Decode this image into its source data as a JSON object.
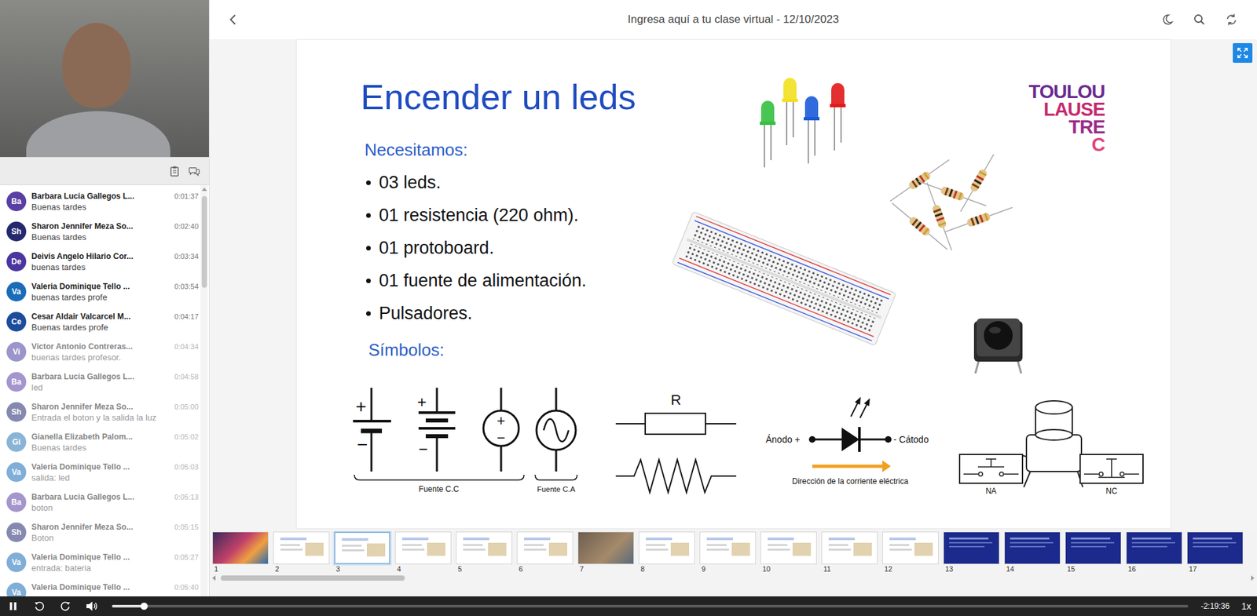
{
  "window": {
    "title": "Ingresa aquí a tu clase virtual - 12/10/2023"
  },
  "chat": {
    "messages": [
      {
        "initials": "Ba",
        "name": "Barbara Lucia Gallegos L...",
        "time": "0:01:37",
        "text": "Buenas tardes",
        "color": "#5a3fa3",
        "faded": false
      },
      {
        "initials": "Sh",
        "name": "Sharon Jennifer Meza So...",
        "time": "0:02:40",
        "text": "Buenas tardes",
        "color": "#24296f",
        "faded": false
      },
      {
        "initials": "De",
        "name": "Deivis Angelo Hilario Cor...",
        "time": "0:03:34",
        "text": "buenas tardes",
        "color": "#4b36a0",
        "faded": false
      },
      {
        "initials": "Va",
        "name": "Valeria Dominique Tello ...",
        "time": "0:03:54",
        "text": "buenas tardes profe",
        "color": "#1a6cb8",
        "faded": false
      },
      {
        "initials": "Ce",
        "name": "Cesar Aldair Valcarcel M...",
        "time": "0:04:17",
        "text": "Buenas tardes profe",
        "color": "#1d4c9b",
        "faded": false
      },
      {
        "initials": "Vi",
        "name": "Victor Antonio Contreras...",
        "time": "0:04:34",
        "text": "buenas tardes profesor.",
        "color": "#4a3fa0",
        "faded": true
      },
      {
        "initials": "Ba",
        "name": "Barbara Lucia Gallegos L...",
        "time": "0:04:58",
        "text": "led",
        "color": "#5a3fa3",
        "faded": true
      },
      {
        "initials": "Sh",
        "name": "Sharon Jennifer Meza So...",
        "time": "0:05:00",
        "text": "Entrada el boton y la salida la luz",
        "color": "#24296f",
        "faded": true
      },
      {
        "initials": "Gi",
        "name": "Gianella Elizabeth Palom...",
        "time": "0:05:02",
        "text": "Buenas tardes",
        "color": "#2b78b5",
        "faded": true
      },
      {
        "initials": "Va",
        "name": "Valeria Dominique Tello ...",
        "time": "0:05:03",
        "text": "salida: led",
        "color": "#1a6cb8",
        "faded": true
      },
      {
        "initials": "Ba",
        "name": "Barbara Lucia Gallegos L...",
        "time": "0:05:13",
        "text": "boton",
        "color": "#5a3fa3",
        "faded": true
      },
      {
        "initials": "Sh",
        "name": "Sharon Jennifer Meza So...",
        "time": "0:05:15",
        "text": "Boton",
        "color": "#24296f",
        "faded": true
      },
      {
        "initials": "Va",
        "name": "Valeria Dominique Tello ...",
        "time": "0:05:27",
        "text": "entrada: bateria",
        "color": "#1a6cb8",
        "faded": true
      },
      {
        "initials": "Va",
        "name": "Valeria Dominique Tello ...",
        "time": "0:05:40",
        "text": "",
        "color": "#1a6cb8",
        "faded": true
      }
    ]
  },
  "slide": {
    "title": "Encender un leds",
    "needs_heading": "Necesitamos:",
    "needs": [
      "03 leds.",
      "01 resistencia (220 ohm).",
      "01 protoboard.",
      "01 fuente de alimentación.",
      "Pulsadores."
    ],
    "symbols_heading": "Símbolos:",
    "logo": [
      {
        "text": "TOULOU",
        "color": "#6a2a90"
      },
      {
        "text": "LAUSE",
        "color": "#c52a6e"
      },
      {
        "text": "TRE",
        "color": "#9a2a88"
      },
      {
        "text": "C",
        "color": "#e0457b"
      }
    ],
    "symbols": {
      "plus": "+",
      "minus": "−",
      "dc_label": "Fuente C.C",
      "ac_label": "Fuente C.A",
      "resistor_label": "R",
      "anode": "Ánodo +",
      "cathode": "- Cátodo",
      "current_label": "Dirección de la corriente eléctrica",
      "open_label": "NA",
      "closed_label": "NC"
    }
  },
  "thumbnails": [
    {
      "number": "1",
      "kind": "cover",
      "selected": false
    },
    {
      "number": "2",
      "kind": "light",
      "selected": false
    },
    {
      "number": "3",
      "kind": "light",
      "selected": true
    },
    {
      "number": "4",
      "kind": "light",
      "selected": false
    },
    {
      "number": "5",
      "kind": "light",
      "selected": false
    },
    {
      "number": "6",
      "kind": "light",
      "selected": false
    },
    {
      "number": "7",
      "kind": "photo",
      "selected": false
    },
    {
      "number": "8",
      "kind": "light",
      "selected": false
    },
    {
      "number": "9",
      "kind": "light",
      "selected": false
    },
    {
      "number": "10",
      "kind": "light",
      "selected": false
    },
    {
      "number": "11",
      "kind": "light",
      "selected": false
    },
    {
      "number": "12",
      "kind": "light",
      "selected": false
    },
    {
      "number": "13",
      "kind": "dark",
      "selected": false
    },
    {
      "number": "14",
      "kind": "dark",
      "selected": false
    },
    {
      "number": "15",
      "kind": "dark",
      "selected": false
    },
    {
      "number": "16",
      "kind": "dark",
      "selected": false
    },
    {
      "number": "17",
      "kind": "dark",
      "selected": false
    }
  ],
  "player": {
    "playing": true,
    "level": 0.03,
    "remaining": "-2:19:36",
    "speed": "1x"
  }
}
